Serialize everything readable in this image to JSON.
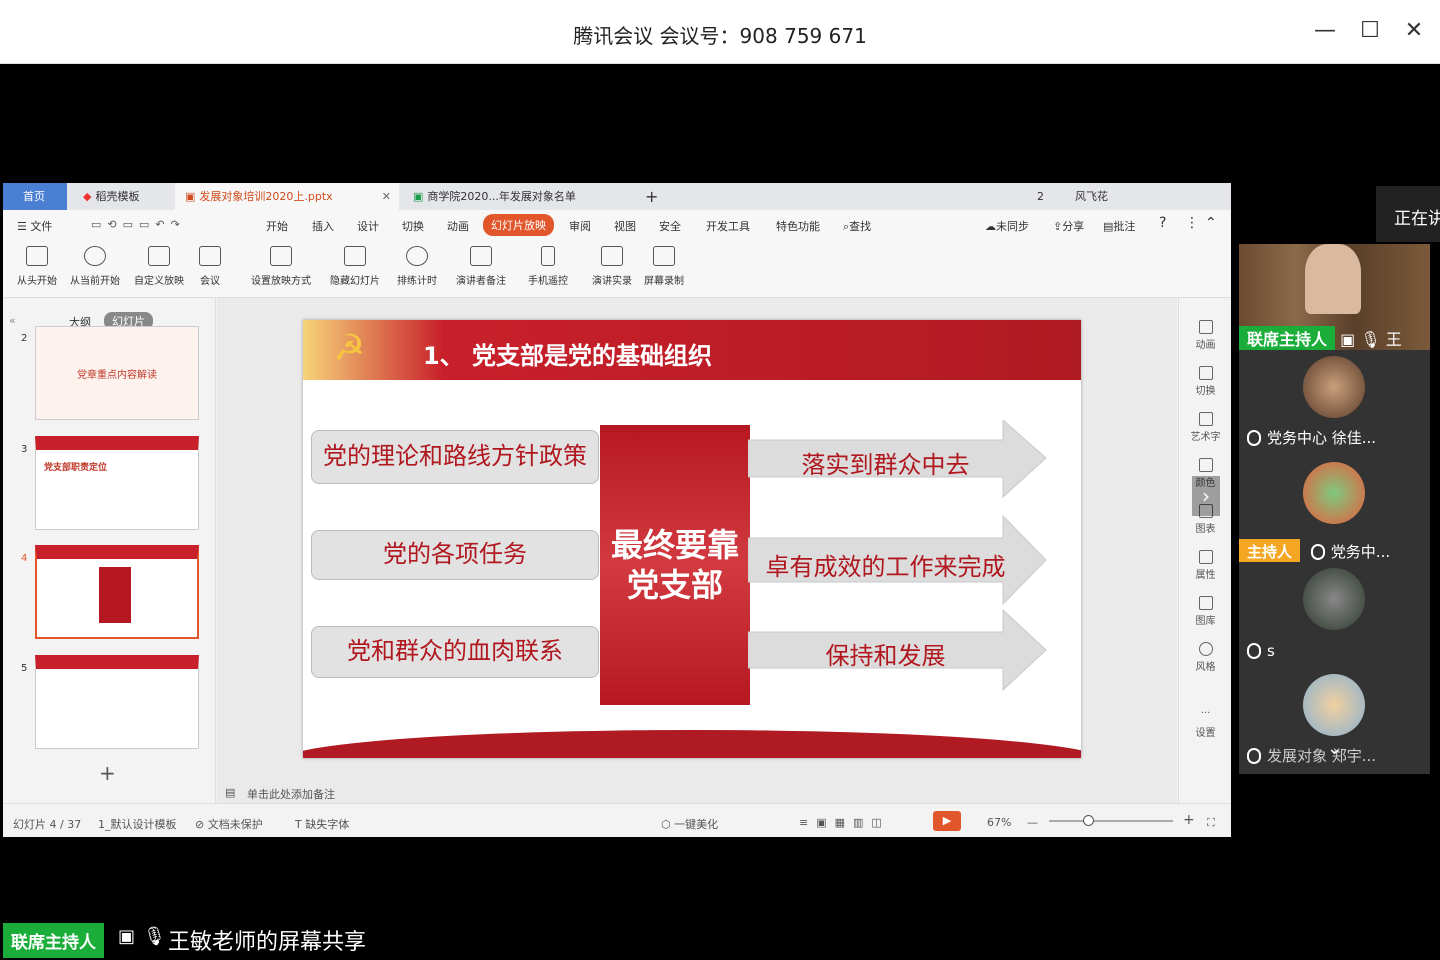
{
  "meeting": {
    "title": "腾讯会议 会议号：908 759 671",
    "minimize_icon": "minimize-icon",
    "speaking_text": "正在讲",
    "share_label": "王敏老师的屏幕共享",
    "share_badge": "联席主持人"
  },
  "wps": {
    "tabs": [
      "首页",
      "稻壳模板",
      "发展对象培训2020上.pptx",
      "商学院2020...年发展对象名单"
    ],
    "new_tab": "+",
    "tab_count": "2",
    "user_name": "风飞花",
    "menu": {
      "file": "文件",
      "items": [
        "开始",
        "插入",
        "设计",
        "切换",
        "动画",
        "幻灯片放映",
        "审阅",
        "视图",
        "安全",
        "开发工具",
        "特色功能"
      ],
      "search": "查找",
      "unsynced": "未同步",
      "share": "分享",
      "comment": "批注"
    },
    "ribbon": [
      "从头开始",
      "从当前开始",
      "自定义放映",
      "会议",
      "设置放映方式",
      "隐藏幻灯片",
      "排练计时",
      "演讲者备注",
      "手机遥控",
      "演讲实录",
      "屏幕录制"
    ],
    "panel_tabs": {
      "outline": "大纲",
      "slides": "幻灯片"
    },
    "thumbs": [
      {
        "num": "2",
        "title": "党章重点内容解读"
      },
      {
        "num": "3",
        "title": "党支部职责定位"
      },
      {
        "num": "4",
        "title": ""
      },
      {
        "num": "5",
        "title": ""
      }
    ],
    "add_slide": "+",
    "notes_placeholder": "单击此处添加备注",
    "right_tools": [
      "动画",
      "切换",
      "艺术字",
      "颜色",
      "图表",
      "属性",
      "图库",
      "风格",
      "设置"
    ],
    "status": {
      "slide_info": "幻灯片 4 / 37",
      "template": "1_默认设计模板",
      "protection": "文档未保护",
      "missing_font": "缺失字体",
      "beautify": "一键美化",
      "zoom": "67%"
    }
  },
  "slide": {
    "title": "1、    党支部是党的基础组织",
    "left_boxes": [
      "党的理论和路线方针政策",
      "党的各项任务",
      "党和群众的血肉联系"
    ],
    "center": "最终要靠党支部",
    "arrows": [
      "落实到群众中去",
      "卓有成效的工作来完成",
      "保持和发展"
    ]
  },
  "participants": [
    {
      "badge": "联席主持人",
      "name": "王",
      "badge_color": "#1aad3a"
    },
    {
      "badge": "",
      "name": "党务中心 徐佳..."
    },
    {
      "badge": "主持人",
      "name": "党务中...",
      "badge_color": "#f5a623"
    },
    {
      "badge": "",
      "name": "s"
    },
    {
      "badge": "",
      "name": "发展对象 郑宇..."
    }
  ]
}
